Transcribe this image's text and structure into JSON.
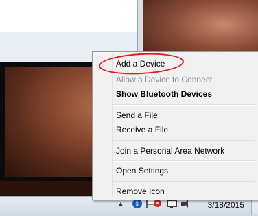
{
  "menu": {
    "items": [
      {
        "label": "Add a Device",
        "state": "enabled"
      },
      {
        "label": "Allow a Device to Connect",
        "state": "disabled"
      },
      {
        "label": "Show Bluetooth Devices",
        "state": "default"
      },
      {
        "label": "Send a File",
        "state": "enabled"
      },
      {
        "label": "Receive a File",
        "state": "enabled"
      },
      {
        "label": "Join a Personal Area Network",
        "state": "enabled"
      },
      {
        "label": "Open Settings",
        "state": "enabled"
      },
      {
        "label": "Remove Icon",
        "state": "enabled"
      }
    ]
  },
  "taskbar": {
    "date": "3/18/2015",
    "tray_icons": [
      "show-hidden-icons-arrow",
      "bluetooth-icon",
      "action-center-flag-icon",
      "network-monitor-icon",
      "speaker-icon"
    ],
    "bluetooth_glyph": "ᛒ",
    "error_badge": "✕"
  },
  "colors": {
    "annotation_oval": "#e01b1b",
    "bluetooth_blue": "#1e5fb7",
    "error_red": "#d42424"
  }
}
